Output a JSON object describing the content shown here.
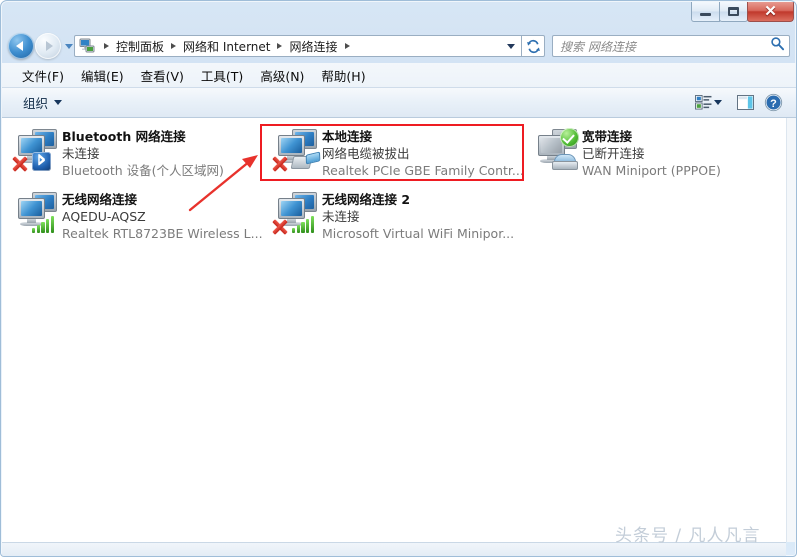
{
  "window": {
    "title": "",
    "controls": {
      "minimize": "–",
      "maximize": "□",
      "close": "✕"
    }
  },
  "nav": {
    "back_icon": "back-arrow-icon",
    "forward_icon": "forward-arrow-icon",
    "history_icon": "history-dropdown-icon",
    "refresh_icon": "refresh-icon"
  },
  "address_bar": {
    "icon": "network-connections-icon",
    "crumbs": [
      "控制面板",
      "网络和 Internet",
      "网络连接"
    ],
    "dropdown_icon": "chevron-down-icon"
  },
  "search": {
    "placeholder": "搜索 网络连接",
    "icon": "search-icon"
  },
  "menubar": {
    "items": [
      "文件(F)",
      "编辑(E)",
      "查看(V)",
      "工具(T)",
      "高级(N)",
      "帮助(H)"
    ]
  },
  "toolbar": {
    "organize_label": "组织",
    "organize_caret": "chevron-down-icon",
    "view_icon": "view-list-icon",
    "view_caret_icon": "chevron-down-icon",
    "preview_icon": "preview-pane-icon",
    "help_icon": "help-icon"
  },
  "connections": [
    {
      "name": "Bluetooth 网络连接",
      "status": "未连接",
      "device": "Bluetooth 设备(个人区域网)",
      "badge": "bluetooth-icon",
      "disconnected": true,
      "grayed": false,
      "col": 0,
      "row": 0
    },
    {
      "name": "本地连接",
      "status": "网络电缆被拔出",
      "device": "Realtek PCIe GBE Family Contr...",
      "badge": "ethernet-plug-icon",
      "disconnected": true,
      "grayed": false,
      "col": 1,
      "row": 0,
      "highlighted": true
    },
    {
      "name": "宽带连接",
      "status": "已断开连接",
      "device": "WAN Miniport (PPPOE)",
      "badge": "wan-modem-icon",
      "disconnected": false,
      "grayed": true,
      "check": true,
      "col": 2,
      "row": 0
    },
    {
      "name": "无线网络连接",
      "status": "AQEDU-AQSZ",
      "device": "Realtek RTL8723BE Wireless L...",
      "badge": "signal-bars-icon",
      "disconnected": false,
      "grayed": false,
      "col": 0,
      "row": 1
    },
    {
      "name": "无线网络连接 2",
      "status": "未连接",
      "device": "Microsoft Virtual WiFi Minipor...",
      "badge": "signal-bars-icon",
      "disconnected": true,
      "grayed": false,
      "col": 1,
      "row": 1
    }
  ],
  "annotations": {
    "highlight_color": "#ee1c22",
    "arrow_color": "#e8322c",
    "highlight_target": "本地连接"
  },
  "watermark": "头条号 / 凡人凡言"
}
